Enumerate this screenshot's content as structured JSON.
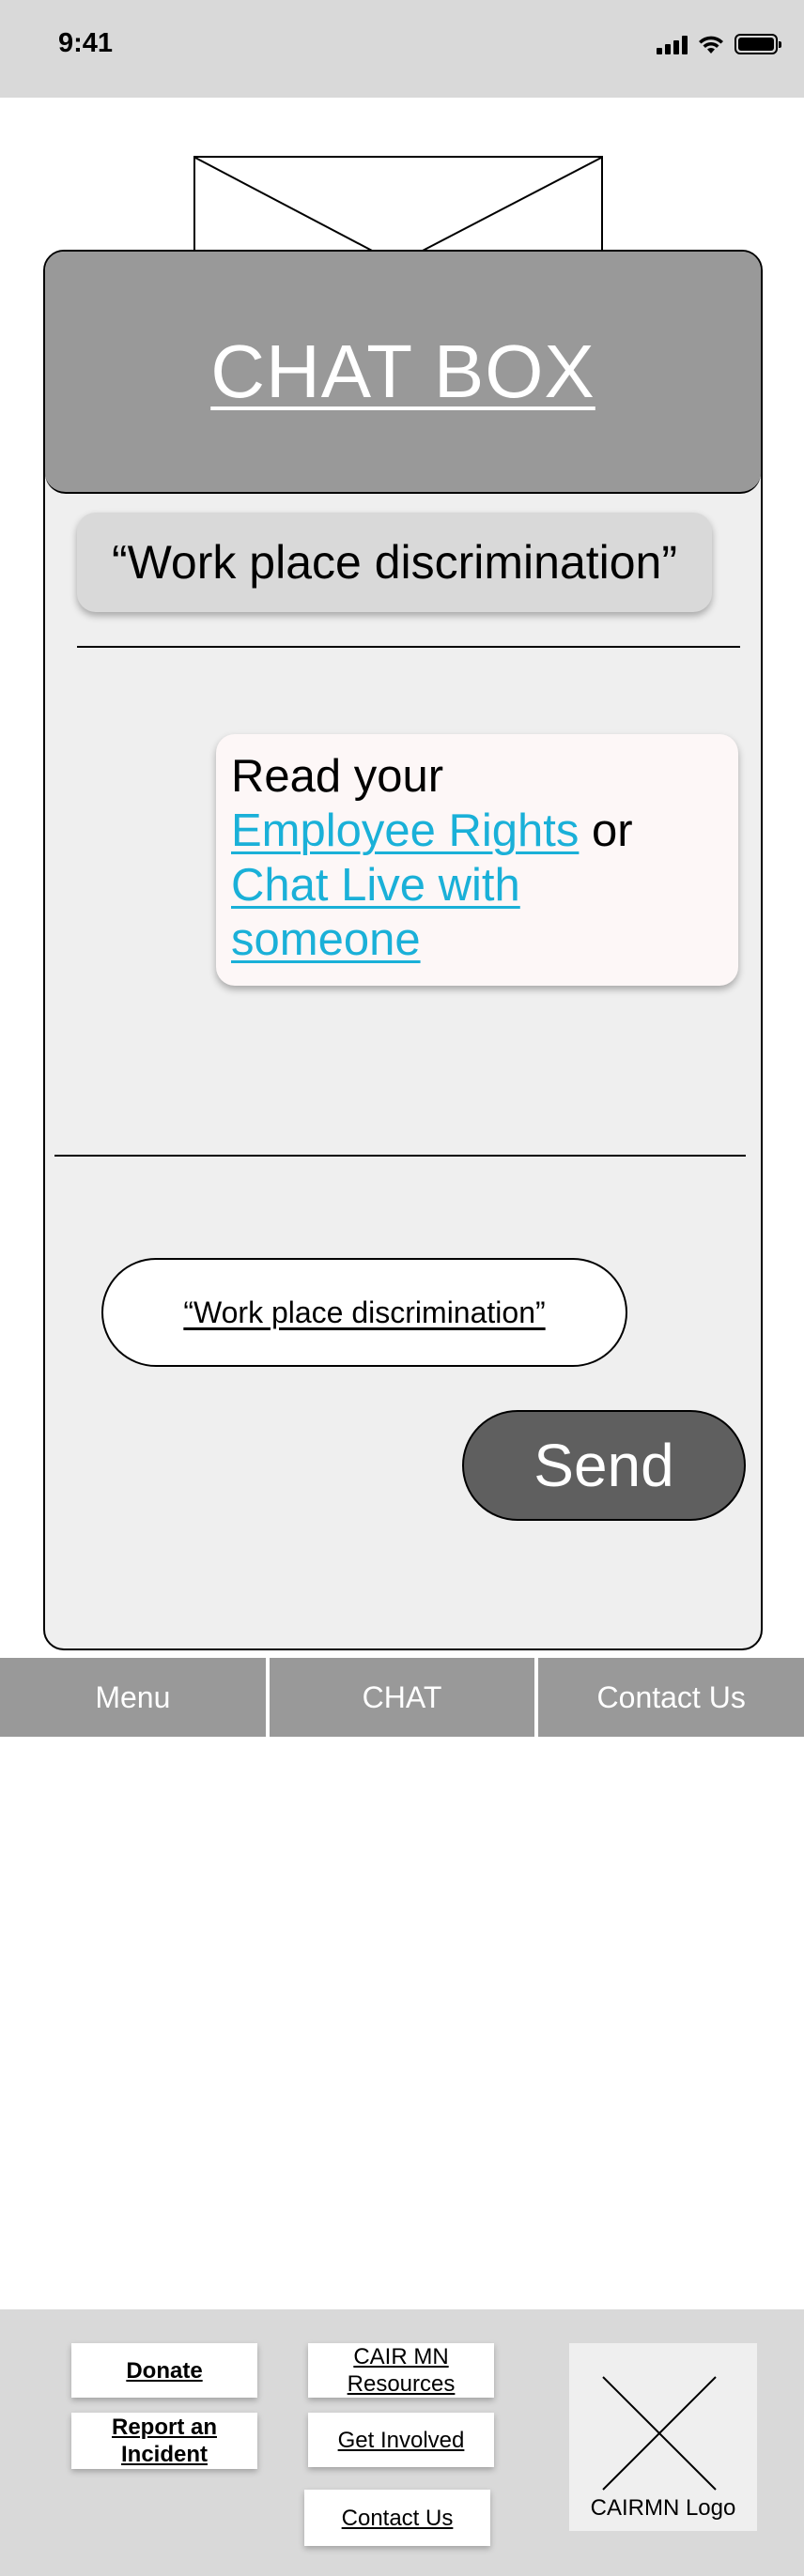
{
  "status_bar": {
    "time": "9:41",
    "icons": [
      "signal-icon",
      "wifi-icon",
      "battery-icon"
    ]
  },
  "chat": {
    "title": "CHAT BOX",
    "user_message": "“Work place discrimination”",
    "bot_message": {
      "prefix": "Read your",
      "link1": "Employee Rights",
      "middle": " or",
      "link2": "Chat Live with someone"
    },
    "input_value": "“Work place discrimination”",
    "send_label": "Send"
  },
  "nav": {
    "items": [
      "Menu",
      "CHAT",
      "Contact Us"
    ]
  },
  "footer": {
    "donate": "Donate",
    "report": "Report an Incident",
    "resources": "CAIR MN Resources",
    "get_involved": "Get Involved",
    "contact": "Contact Us",
    "logo_label": "CAIRMN Logo"
  },
  "colors": {
    "header_gray": "#999999",
    "card_bg": "#efefef",
    "link": "#1ab0d8",
    "send_button": "#5f5f5f",
    "status_bar": "#d9d9d9"
  }
}
